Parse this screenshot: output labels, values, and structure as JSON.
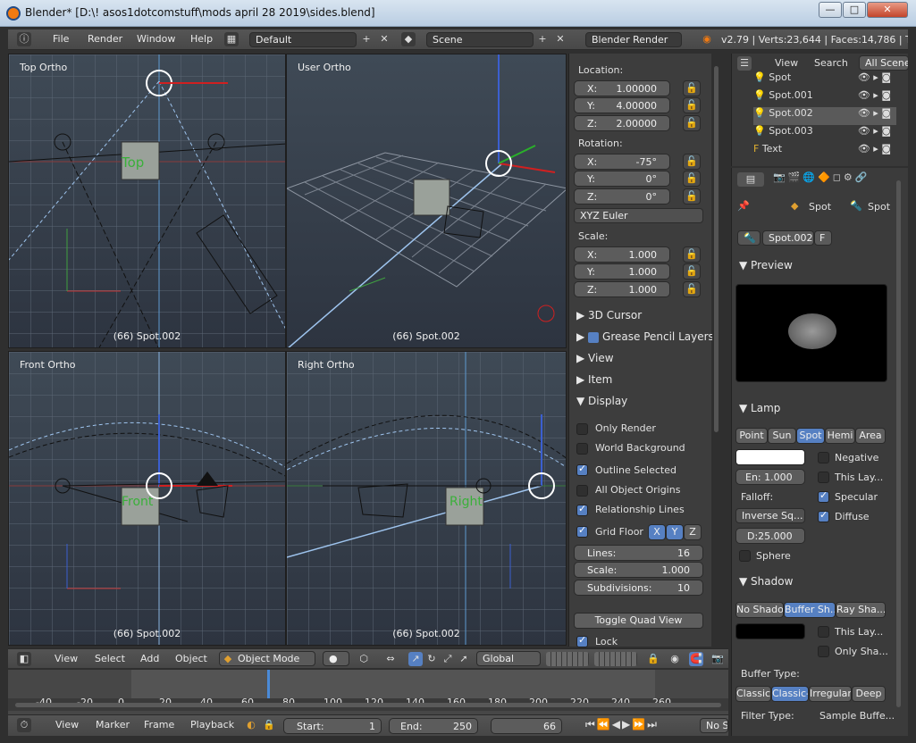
{
  "window": {
    "title": "Blender* [D:\\! asos1dotcomstuff\\mods april 28 2019\\sides.blend]",
    "min": "—",
    "max": "□",
    "close": "✕"
  },
  "infobar": {
    "menus": [
      "File",
      "Render",
      "Window",
      "Help"
    ],
    "screen": "Default",
    "scene": "Scene",
    "engine": "Blender Render",
    "stats": "v2.79 | Verts:23,644 | Faces:14,786 | Tris"
  },
  "viewports": {
    "tl": {
      "name": "Top Ortho",
      "footer": "(66) Spot.002",
      "cube": "Top"
    },
    "tr": {
      "name": "User Ortho",
      "footer": "(66) Spot.002"
    },
    "bl": {
      "name": "Front Ortho",
      "footer": "(66) Spot.002",
      "cube": "Front"
    },
    "br": {
      "name": "Right Ortho",
      "footer": "(66) Spot.002",
      "cube": "Right"
    }
  },
  "npanel": {
    "location_label": "Location:",
    "loc": [
      {
        "k": "X:",
        "v": "1.00000"
      },
      {
        "k": "Y:",
        "v": "4.00000"
      },
      {
        "k": "Z:",
        "v": "2.00000"
      }
    ],
    "rotation_label": "Rotation:",
    "rot": [
      {
        "k": "X:",
        "v": "-75°"
      },
      {
        "k": "Y:",
        "v": "0°"
      },
      {
        "k": "Z:",
        "v": "0°"
      }
    ],
    "rot_mode": "XYZ Euler",
    "scale_label": "Scale:",
    "scale": [
      {
        "k": "X:",
        "v": "1.000"
      },
      {
        "k": "Y:",
        "v": "1.000"
      },
      {
        "k": "Z:",
        "v": "1.000"
      }
    ],
    "sections": [
      "3D Cursor",
      "Grease Pencil Layers",
      "View",
      "Item",
      "Display"
    ],
    "display": {
      "only_render": "Only Render",
      "world_bg": "World Background",
      "outline_sel": "Outline Selected",
      "all_origins": "All Object Origins",
      "rel_lines": "Relationship Lines",
      "grid_floor": "Grid Floor",
      "axes": [
        "X",
        "Y",
        "Z"
      ],
      "lines_k": "Lines:",
      "lines_v": "16",
      "scale_k": "Scale:",
      "scale_v": "1.000",
      "subdiv_k": "Subdivisions:",
      "subdiv_v": "10",
      "quad": "Toggle Quad View",
      "lock": "Lock"
    }
  },
  "outliner": {
    "view": "View",
    "search": "Search",
    "filter": "All Scenes",
    "rows": [
      "Spot",
      "Spot.001",
      "Spot.002",
      "Spot.003",
      "Text"
    ]
  },
  "props": {
    "ctx1": "Spot",
    "ctx2": "Spot",
    "datablock": "Spot.002",
    "fake": "F",
    "preview": "Preview",
    "lamp": "Lamp",
    "lamp_types": [
      "Point",
      "Sun",
      "Spot",
      "Hemi",
      "Area"
    ],
    "energy": "En: 1.000",
    "falloff": "Falloff:",
    "falloff_v": "Inverse Sq...",
    "distance": "D:25.000",
    "negative": "Negative",
    "this_layer": "This Lay...",
    "specular": "Specular",
    "diffuse": "Diffuse",
    "sphere": "Sphere",
    "shadow": "Shadow",
    "shadow_types": [
      "No Shado",
      "Buffer Sh...",
      "Ray Sha..."
    ],
    "this_layer2": "This Lay...",
    "only_shadow": "Only Sha...",
    "buffer_type": "Buffer Type:",
    "buffer_types": [
      "Classic",
      "Classic-",
      "Irregular",
      "Deep"
    ],
    "filter_type": "Filter Type:",
    "sample_buffers": "Sample Buffe..."
  },
  "toolbar3d": {
    "menus": [
      "View",
      "Select",
      "Add",
      "Object"
    ],
    "mode": "Object Mode",
    "orientation": "Global"
  },
  "timeline": {
    "ticks": [
      "-40",
      "-20",
      "0",
      "20",
      "40",
      "60",
      "80",
      "100",
      "120",
      "140",
      "160",
      "180",
      "200",
      "220",
      "240",
      "260"
    ]
  },
  "tlbar": {
    "menus": [
      "View",
      "Marker",
      "Frame",
      "Playback"
    ],
    "start": "Start:",
    "start_v": "1",
    "end": "End:",
    "end_v": "250",
    "current": "66",
    "nosync": "No S"
  }
}
